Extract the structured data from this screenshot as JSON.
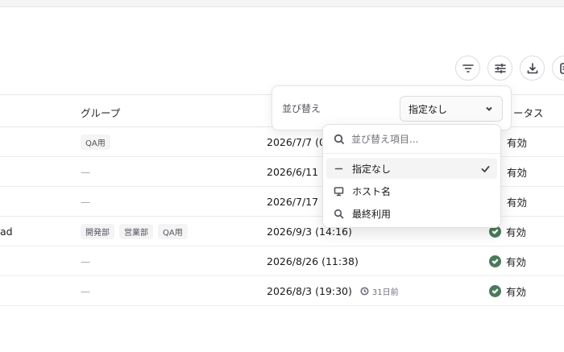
{
  "toolbar": {
    "buttons": [
      {
        "icon": "filter-icon"
      },
      {
        "icon": "sliders-icon"
      },
      {
        "icon": "download-icon"
      },
      {
        "icon": "device-sync-icon"
      }
    ]
  },
  "table": {
    "headers": {
      "group": "グループ",
      "status": "ータス"
    },
    "rows": [
      {
        "name": "",
        "groups": [
          "QA用"
        ],
        "date": "2026/7/7 (0",
        "relative": "",
        "status": "有効"
      },
      {
        "name": "",
        "groups": [],
        "date": "2026/6/11 (",
        "relative": "",
        "status": "有効"
      },
      {
        "name": "",
        "groups": [],
        "date": "2026/7/17 (",
        "relative": "",
        "status": "有効"
      },
      {
        "name": "ad",
        "groups": [
          "開発部",
          "営業部",
          "QA用"
        ],
        "date": "2026/9/3 (14:16)",
        "relative": "",
        "status": "有効"
      },
      {
        "name": "",
        "groups": [],
        "date": "2026/8/26 (11:38)",
        "relative": "",
        "status": "有効"
      },
      {
        "name": "",
        "groups": [],
        "date": "2026/8/3 (19:30)",
        "relative": "31日前",
        "status": "有効"
      }
    ],
    "dash": "—"
  },
  "sort": {
    "label": "並び替え",
    "selected": "指定なし"
  },
  "dropdown": {
    "placeholder": "並び替え項目...",
    "items": [
      {
        "label": "指定なし",
        "icon": "minus-icon",
        "selected": true
      },
      {
        "label": "ホスト名",
        "icon": "monitor-icon",
        "selected": false
      },
      {
        "label": "最終利用",
        "icon": "search-icon",
        "selected": false
      }
    ]
  }
}
